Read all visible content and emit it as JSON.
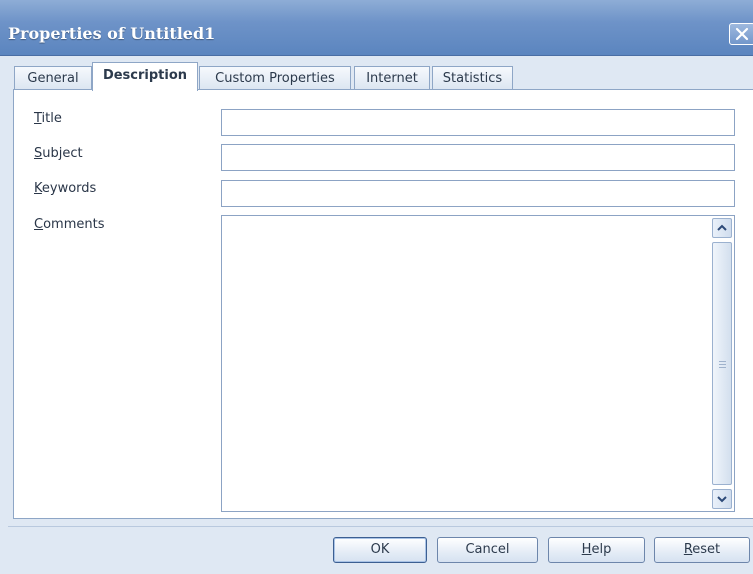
{
  "window": {
    "title": "Properties of Untitled1"
  },
  "tabs": [
    {
      "label": "General",
      "active": false
    },
    {
      "label": "Description",
      "active": true
    },
    {
      "label": "Custom Properties",
      "active": false
    },
    {
      "label": "Internet",
      "active": false
    },
    {
      "label": "Statistics",
      "active": false
    }
  ],
  "fields": {
    "title": {
      "accel": "T",
      "rest": "itle",
      "value": ""
    },
    "subject": {
      "accel": "S",
      "rest": "ubject",
      "value": ""
    },
    "keywords": {
      "accel": "K",
      "rest": "eywords",
      "value": ""
    },
    "comments": {
      "accel": "C",
      "rest": "omments",
      "value": ""
    }
  },
  "buttons": {
    "ok": {
      "label": "OK"
    },
    "cancel": {
      "label": "Cancel"
    },
    "help": {
      "accel": "H",
      "rest": "elp"
    },
    "reset": {
      "accel": "R",
      "rest": "eset"
    }
  },
  "icons": {
    "close": "close-icon",
    "scroll_up": "chevron-up-icon",
    "scroll_down": "chevron-down-icon"
  },
  "colors": {
    "titlebar": "#6e93c8",
    "dialog_bg": "#dfe8f3",
    "border": "#8ea6c6"
  }
}
